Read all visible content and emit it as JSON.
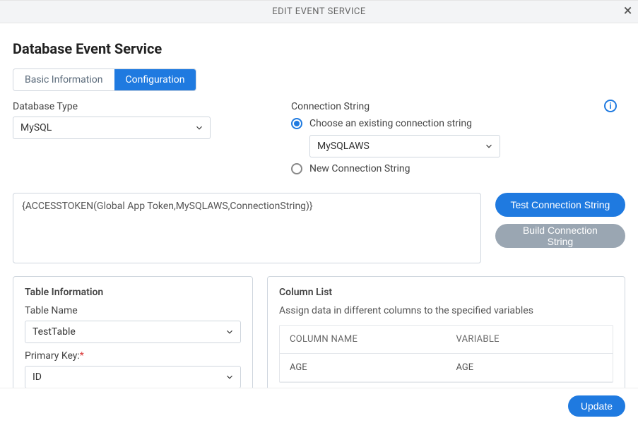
{
  "header": {
    "title": "EDIT EVENT SERVICE"
  },
  "page": {
    "title": "Database Event Service"
  },
  "tabs": {
    "basic": "Basic Information",
    "config": "Configuration"
  },
  "dbtype": {
    "label": "Database Type",
    "value": "MySQL"
  },
  "connection": {
    "label": "Connection String",
    "existing_label": "Choose an existing connection string",
    "existing_value": "MySQLAWS",
    "new_label": "New Connection String",
    "textarea_value": "{ACCESSTOKEN(Global App Token,MySQLAWS,ConnectionString)}"
  },
  "buttons": {
    "test": "Test Connection String",
    "build": "Build Connection String",
    "update": "Update"
  },
  "table_info": {
    "title": "Table Information",
    "table_name_label": "Table Name",
    "table_name_value": "TestTable",
    "pk_label": "Primary Key:",
    "pk_value": "ID"
  },
  "column_list": {
    "title": "Column List",
    "subtitle": "Assign data in different columns to the specified variables",
    "head_col": "COLUMN NAME",
    "head_var": "VARIABLE",
    "rows": [
      {
        "col": "AGE",
        "var": "AGE"
      }
    ]
  }
}
